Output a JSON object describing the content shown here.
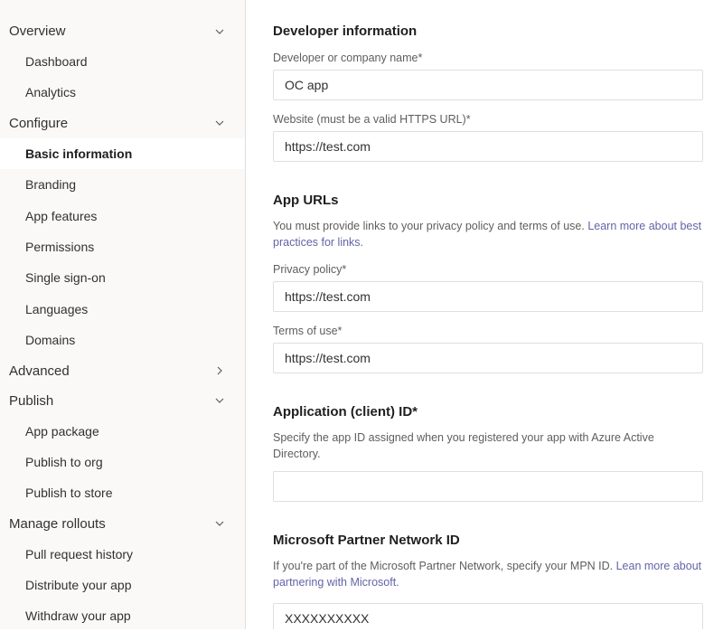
{
  "sidebar": {
    "sections": [
      {
        "label": "Overview",
        "expanded": true,
        "items": [
          {
            "label": "Dashboard"
          },
          {
            "label": "Analytics"
          }
        ]
      },
      {
        "label": "Configure",
        "expanded": true,
        "items": [
          {
            "label": "Basic information",
            "active": true
          },
          {
            "label": "Branding"
          },
          {
            "label": "App features"
          },
          {
            "label": "Permissions"
          },
          {
            "label": "Single sign-on"
          },
          {
            "label": "Languages"
          },
          {
            "label": "Domains"
          }
        ]
      },
      {
        "label": "Advanced",
        "expanded": false,
        "items": []
      },
      {
        "label": "Publish",
        "expanded": true,
        "items": [
          {
            "label": "App package"
          },
          {
            "label": "Publish to org"
          },
          {
            "label": "Publish to store"
          }
        ]
      },
      {
        "label": "Manage rollouts",
        "expanded": true,
        "items": [
          {
            "label": "Pull request history"
          },
          {
            "label": "Distribute your app"
          },
          {
            "label": "Withdraw your app"
          }
        ]
      }
    ]
  },
  "main": {
    "devinfo": {
      "heading": "Developer information",
      "name_label": "Developer or company name*",
      "name_value": "OC app",
      "website_label": "Website (must be a valid HTTPS URL)*",
      "website_value": "https://test.com"
    },
    "appurls": {
      "heading": "App URLs",
      "desc_prefix": "You must provide links to your privacy policy and terms of use. ",
      "desc_link": "Learn more about best practices for links.",
      "privacy_label": "Privacy policy*",
      "privacy_value": "https://test.com",
      "terms_label": "Terms of use*",
      "terms_value": "https://test.com"
    },
    "clientid": {
      "heading": "Application (client) ID*",
      "desc": "Specify the app ID assigned when you registered your app with Azure Active Directory.",
      "value": ""
    },
    "mpn": {
      "heading": "Microsoft Partner Network ID",
      "desc_prefix": "If you're part of the Microsoft Partner Network, specify your MPN ID. ",
      "desc_link": "Lean more about partnering with Microsoft.",
      "value": "XXXXXXXXXX"
    }
  }
}
